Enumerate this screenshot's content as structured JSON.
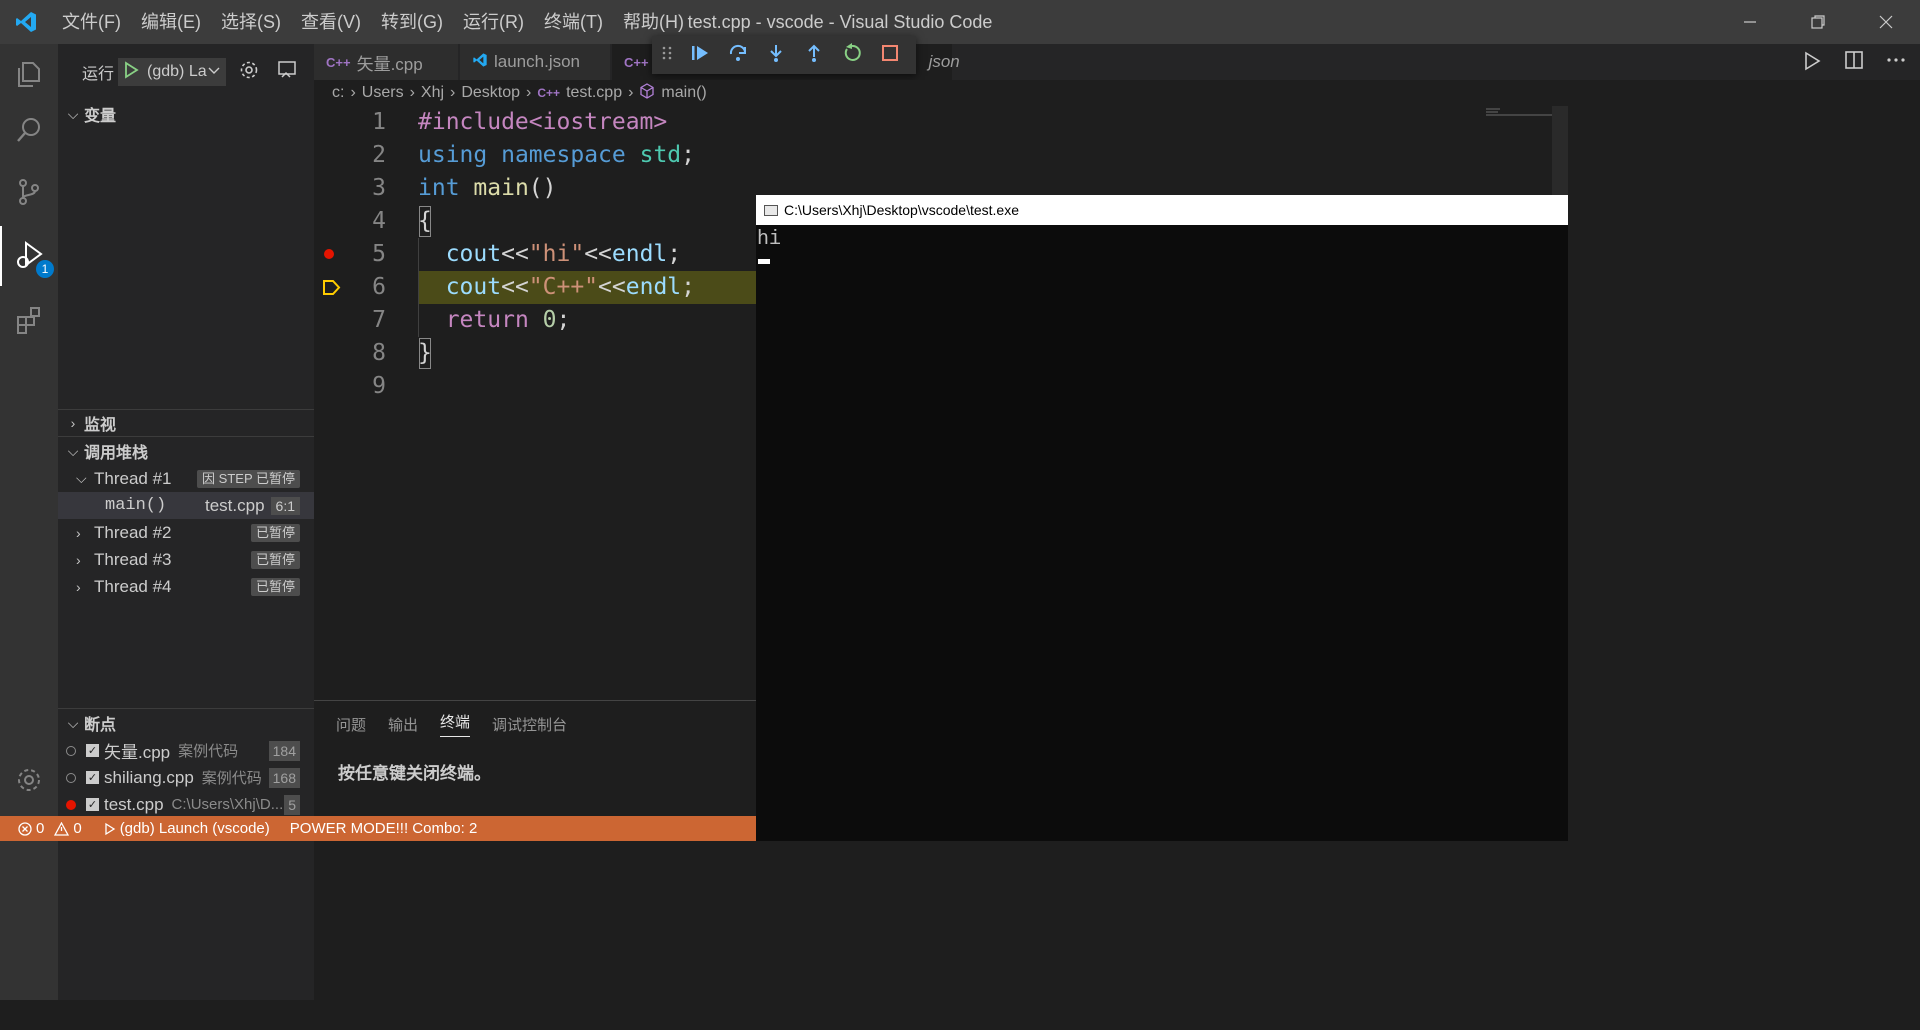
{
  "window": {
    "title": "test.cpp - vscode - Visual Studio Code",
    "menu": [
      "文件(F)",
      "编辑(E)",
      "选择(S)",
      "查看(V)",
      "转到(G)",
      "运行(R)",
      "终端(T)",
      "帮助(H)"
    ]
  },
  "activity": {
    "debug_badge": "1"
  },
  "sidebar": {
    "run_label": "运行",
    "launch_config": "(gdb) Launch",
    "variables_header": "变量",
    "watch_header": "监视",
    "callstack_header": "调用堆栈",
    "threads": [
      {
        "label": "Thread #1",
        "status": "因 STEP 已暂停"
      },
      {
        "label": "Thread #2",
        "status": "已暂停"
      },
      {
        "label": "Thread #3",
        "status": "已暂停"
      },
      {
        "label": "Thread #4",
        "status": "已暂停"
      }
    ],
    "frame": {
      "fn": "main()",
      "file": "test.cpp",
      "pos": "6:1"
    },
    "breakpoints_header": "断点",
    "breakpoints": [
      {
        "name": "矢量.cpp",
        "desc": "案例代码",
        "line": "184"
      },
      {
        "name": "shiliang.cpp",
        "desc": "案例代码",
        "line": "168"
      },
      {
        "name": "test.cpp",
        "desc": "C:\\Users\\Xhj\\D...",
        "line": "5"
      }
    ]
  },
  "tabs": [
    {
      "label": "矢量.cpp"
    },
    {
      "label": "launch.json"
    },
    {
      "label": "json"
    }
  ],
  "breadcrumb": [
    "c:",
    "Users",
    "Xhj",
    "Desktop",
    "test.cpp",
    "main()"
  ],
  "code": {
    "line_numbers": [
      "1",
      "2",
      "3",
      "4",
      "5",
      "6",
      "7",
      "8",
      "9"
    ],
    "lines": [
      "#include<iostream>",
      "using namespace std;",
      "int main()",
      "{",
      "  cout<<\"hi\"<<endl;",
      "  cout<<\"C++\"<<endl;",
      "  return 0;",
      "}",
      ""
    ]
  },
  "panel": {
    "tabs": [
      "问题",
      "输出",
      "终端",
      "调试控制台"
    ],
    "active_tab": "终端",
    "message": "按任意键关闭终端。"
  },
  "console": {
    "title": "C:\\Users\\Xhj\\Desktop\\vscode\\test.exe",
    "output": "hi"
  },
  "status": {
    "errors": "0",
    "warnings": "0",
    "debug_config": "(gdb) Launch (vscode)",
    "power_mode": "POWER MODE!!! Combo: 2"
  },
  "colors": {
    "accent": "#007acc",
    "status_bg": "#cc6633",
    "highlight": "#4b4b18"
  }
}
